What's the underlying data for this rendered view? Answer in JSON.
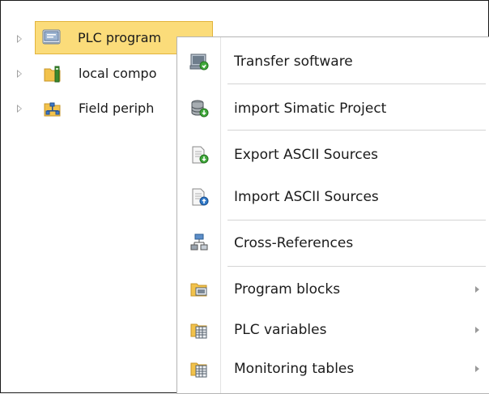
{
  "tree": {
    "items": [
      {
        "label": "PLC program",
        "icon": "plc-program-icon",
        "selected": true
      },
      {
        "label": "local compo",
        "icon": "local-modules-folder-icon"
      },
      {
        "label": "Field periph",
        "icon": "field-periphery-folder-icon"
      }
    ]
  },
  "menu": {
    "items": [
      {
        "label": "Transfer software",
        "icon": "transfer-software-icon"
      },
      {
        "label": "import Simatic Project",
        "icon": "import-project-icon"
      },
      {
        "label": "Export ASCII Sources",
        "icon": "export-sources-icon"
      },
      {
        "label": "Import ASCII Sources",
        "icon": "import-sources-icon"
      },
      {
        "label": "Cross-References",
        "icon": "cross-references-icon"
      },
      {
        "label": "Program blocks",
        "icon": "program-blocks-folder-icon",
        "submenu": true
      },
      {
        "label": "PLC variables",
        "icon": "plc-variables-icon",
        "submenu": true
      },
      {
        "label": "Monitoring tables",
        "icon": "monitoring-tables-icon",
        "submenu": true
      }
    ]
  },
  "colors": {
    "selection_fill": "#fbdc7a",
    "selection_border": "#e2b43c",
    "menu_border": "#b5b5b5"
  }
}
